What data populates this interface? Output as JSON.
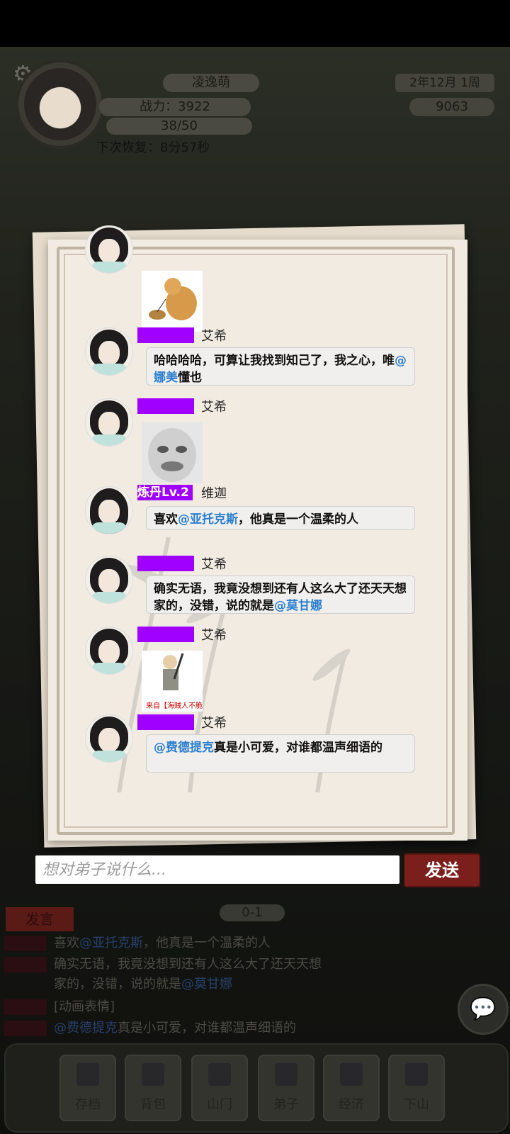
{
  "hud": {
    "player_name": "凌逸萌",
    "power": "战力：3922",
    "energy": "38/50",
    "recovery": "下次恢复：8分57秒",
    "date": "2年12月  1周",
    "money": "9063"
  },
  "chat": {
    "messages": [
      {
        "kind": "sticker",
        "user": "",
        "tag": "",
        "sticker": "shiba-dog-walking-sticker"
      },
      {
        "kind": "text",
        "user": "艾希",
        "tag": "",
        "parts": [
          {
            "t": "哈哈哈哈，可算让我找到知己了，我之心"
          },
          {
            "t": "，唯"
          },
          {
            "t": "@娜美",
            "at": true
          },
          {
            "t": "懂也"
          }
        ]
      },
      {
        "kind": "sticker",
        "user": "艾希",
        "tag": "",
        "sticker": "meme-face-sticker"
      },
      {
        "kind": "text",
        "user": "维迦",
        "tag": "炼丹Lv.2",
        "parts": [
          {
            "t": "喜欢"
          },
          {
            "t": "@亚托克斯",
            "at": true
          },
          {
            "t": "，他真是一个温柔的人"
          }
        ]
      },
      {
        "kind": "text",
        "user": "艾希",
        "tag": "",
        "parts": [
          {
            "t": "确实无语，我竟没想到还有人这么大了还"
          },
          {
            "t": "天天想家的，没错，说的就是"
          },
          {
            "t": "@莫甘娜",
            "at": true
          }
        ]
      },
      {
        "kind": "sticker",
        "user": "艾希",
        "tag": "",
        "sticker": "cartoon-man-sticker",
        "sticker_text": "来自【海贼人不脆"
      },
      {
        "kind": "text",
        "user": "艾希",
        "tag": "",
        "parts": [
          {
            "t": "@费德提克",
            "at": true
          },
          {
            "t": "真是小可爱，对谁都温声细语"
          },
          {
            "t": "的"
          }
        ]
      }
    ]
  },
  "input": {
    "placeholder": "想对弟子说什么...",
    "send_label": "发送"
  },
  "background_log": {
    "speak_label": "发言",
    "page": "0-1",
    "lines": [
      {
        "parts": [
          {
            "t": "喜欢"
          },
          {
            "t": "@亚托克斯",
            "at": true
          },
          {
            "t": "，他真是一个温柔的人"
          }
        ]
      },
      {
        "parts": [
          {
            "t": "确实无语，我竟没想到还有人这么大了还天天想"
          }
        ]
      },
      {
        "parts": [
          {
            "t": "家的，没错，说的就是"
          },
          {
            "t": "@莫甘娜",
            "at": true
          }
        ]
      },
      {
        "parts": [
          {
            "t": "[动画表情]"
          }
        ]
      },
      {
        "parts": [
          {
            "t": "@费德提克",
            "at": true
          },
          {
            "t": "真是小可爱，对谁都温声细语的"
          }
        ]
      }
    ]
  },
  "nav": [
    {
      "label": "存档"
    },
    {
      "label": "背包"
    },
    {
      "label": "山门"
    },
    {
      "label": "弟子"
    },
    {
      "label": "经济"
    },
    {
      "label": "下山"
    }
  ],
  "colors": {
    "accent_purple": "#a000ff",
    "at_blue": "#2b7fd0",
    "send_red": "#7a1f1c"
  }
}
